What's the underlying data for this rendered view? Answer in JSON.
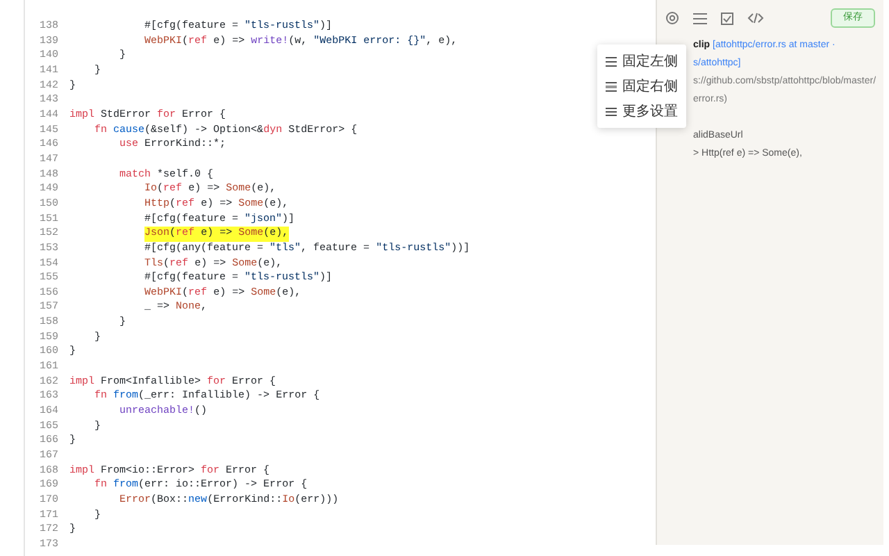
{
  "code_lines": [
    {
      "number": "138",
      "highlighted": false,
      "tokens": [
        {
          "kind": "plain",
          "text": "            #[cfg(feature = "
        },
        {
          "kind": "string",
          "text": "\"tls-rustls\""
        },
        {
          "kind": "plain",
          "text": ")]"
        }
      ]
    },
    {
      "number": "139",
      "highlighted": false,
      "tokens": [
        {
          "kind": "variant",
          "text": "            WebPKI"
        },
        {
          "kind": "plain",
          "text": "("
        },
        {
          "kind": "keyword",
          "text": "ref"
        },
        {
          "kind": "plain",
          "text": " e) => "
        },
        {
          "kind": "macro",
          "text": "write!"
        },
        {
          "kind": "plain",
          "text": "(w, "
        },
        {
          "kind": "string",
          "text": "\"WebPKI error: {}\""
        },
        {
          "kind": "plain",
          "text": ", e),"
        }
      ]
    },
    {
      "number": "140",
      "highlighted": false,
      "tokens": [
        {
          "kind": "plain",
          "text": "        }"
        }
      ]
    },
    {
      "number": "141",
      "highlighted": false,
      "tokens": [
        {
          "kind": "plain",
          "text": "    }"
        }
      ]
    },
    {
      "number": "142",
      "highlighted": false,
      "tokens": [
        {
          "kind": "plain",
          "text": "}"
        }
      ]
    },
    {
      "number": "143"
    },
    {
      "number": "144",
      "highlighted": false,
      "tokens": [
        {
          "kind": "keyword",
          "text": "impl"
        },
        {
          "kind": "plain",
          "text": " StdError "
        },
        {
          "kind": "keyword",
          "text": "for"
        },
        {
          "kind": "plain",
          "text": " Error {"
        }
      ]
    },
    {
      "number": "145",
      "highlighted": false,
      "tokens": [
        {
          "kind": "keyword",
          "text": "    fn"
        },
        {
          "kind": "function",
          "text": " cause"
        },
        {
          "kind": "plain",
          "text": "(&self) -> Option<&"
        },
        {
          "kind": "keyword",
          "text": "dyn"
        },
        {
          "kind": "plain",
          "text": " StdError> {"
        }
      ]
    },
    {
      "number": "146",
      "highlighted": false,
      "tokens": [
        {
          "kind": "keyword",
          "text": "        use"
        },
        {
          "kind": "plain",
          "text": " ErrorKind::*;"
        }
      ]
    },
    {
      "number": "147"
    },
    {
      "number": "148",
      "highlighted": false,
      "tokens": [
        {
          "kind": "keyword",
          "text": "        match"
        },
        {
          "kind": "plain",
          "text": " *self.0 {"
        }
      ]
    },
    {
      "number": "149",
      "highlighted": false,
      "tokens": [
        {
          "kind": "variant",
          "text": "            Io"
        },
        {
          "kind": "plain",
          "text": "("
        },
        {
          "kind": "keyword",
          "text": "ref"
        },
        {
          "kind": "plain",
          "text": " e) => "
        },
        {
          "kind": "variant",
          "text": "Some"
        },
        {
          "kind": "plain",
          "text": "(e),"
        }
      ]
    },
    {
      "number": "150",
      "highlighted": false,
      "tokens": [
        {
          "kind": "variant",
          "text": "            Http"
        },
        {
          "kind": "plain",
          "text": "("
        },
        {
          "kind": "keyword",
          "text": "ref"
        },
        {
          "kind": "plain",
          "text": " e) => "
        },
        {
          "kind": "variant",
          "text": "Some"
        },
        {
          "kind": "plain",
          "text": "(e),"
        }
      ]
    },
    {
      "number": "151",
      "highlighted": false,
      "tokens": [
        {
          "kind": "plain",
          "text": "            #[cfg(feature = "
        },
        {
          "kind": "string",
          "text": "\"json\""
        },
        {
          "kind": "plain",
          "text": ")]"
        }
      ]
    },
    {
      "number": "152",
      "highlighted": true,
      "tokens": [
        {
          "kind": "variant",
          "text": "            Json"
        },
        {
          "kind": "plain",
          "text": "("
        },
        {
          "kind": "keyword",
          "text": "ref"
        },
        {
          "kind": "plain",
          "text": " e) => "
        },
        {
          "kind": "variant",
          "text": "Some"
        },
        {
          "kind": "plain",
          "text": "(e),"
        }
      ]
    },
    {
      "number": "153",
      "highlighted": false,
      "tokens": [
        {
          "kind": "plain",
          "text": "            #[cfg(any(feature = "
        },
        {
          "kind": "string",
          "text": "\"tls\""
        },
        {
          "kind": "plain",
          "text": ", feature = "
        },
        {
          "kind": "string",
          "text": "\"tls-rustls\""
        },
        {
          "kind": "plain",
          "text": "))]"
        }
      ]
    },
    {
      "number": "154",
      "highlighted": false,
      "tokens": [
        {
          "kind": "variant",
          "text": "            Tls"
        },
        {
          "kind": "plain",
          "text": "("
        },
        {
          "kind": "keyword",
          "text": "ref"
        },
        {
          "kind": "plain",
          "text": " e) => "
        },
        {
          "kind": "variant",
          "text": "Some"
        },
        {
          "kind": "plain",
          "text": "(e),"
        }
      ]
    },
    {
      "number": "155",
      "highlighted": false,
      "tokens": [
        {
          "kind": "plain",
          "text": "            #[cfg(feature = "
        },
        {
          "kind": "string",
          "text": "\"tls-rustls\""
        },
        {
          "kind": "plain",
          "text": ")]"
        }
      ]
    },
    {
      "number": "156",
      "highlighted": false,
      "tokens": [
        {
          "kind": "variant",
          "text": "            WebPKI"
        },
        {
          "kind": "plain",
          "text": "("
        },
        {
          "kind": "keyword",
          "text": "ref"
        },
        {
          "kind": "plain",
          "text": " e) => "
        },
        {
          "kind": "variant",
          "text": "Some"
        },
        {
          "kind": "plain",
          "text": "(e),"
        }
      ]
    },
    {
      "number": "157",
      "highlighted": false,
      "tokens": [
        {
          "kind": "plain",
          "text": "            _ => "
        },
        {
          "kind": "variant",
          "text": "None"
        },
        {
          "kind": "plain",
          "text": ","
        }
      ]
    },
    {
      "number": "158",
      "highlighted": false,
      "tokens": [
        {
          "kind": "plain",
          "text": "        }"
        }
      ]
    },
    {
      "number": "159",
      "highlighted": false,
      "tokens": [
        {
          "kind": "plain",
          "text": "    }"
        }
      ]
    },
    {
      "number": "160",
      "highlighted": false,
      "tokens": [
        {
          "kind": "plain",
          "text": "}"
        }
      ]
    },
    {
      "number": "161"
    },
    {
      "number": "162",
      "highlighted": false,
      "tokens": [
        {
          "kind": "keyword",
          "text": "impl"
        },
        {
          "kind": "plain",
          "text": " From<Infallible> "
        },
        {
          "kind": "keyword",
          "text": "for"
        },
        {
          "kind": "plain",
          "text": " Error {"
        }
      ]
    },
    {
      "number": "163",
      "highlighted": false,
      "tokens": [
        {
          "kind": "keyword",
          "text": "    fn"
        },
        {
          "kind": "function",
          "text": " from"
        },
        {
          "kind": "plain",
          "text": "(_err: Infallible) -> Error {"
        }
      ]
    },
    {
      "number": "164",
      "highlighted": false,
      "tokens": [
        {
          "kind": "macro",
          "text": "        unreachable!"
        },
        {
          "kind": "plain",
          "text": "()"
        }
      ]
    },
    {
      "number": "165",
      "highlighted": false,
      "tokens": [
        {
          "kind": "plain",
          "text": "    }"
        }
      ]
    },
    {
      "number": "166",
      "highlighted": false,
      "tokens": [
        {
          "kind": "plain",
          "text": "}"
        }
      ]
    },
    {
      "number": "167"
    },
    {
      "number": "168",
      "highlighted": false,
      "tokens": [
        {
          "kind": "keyword",
          "text": "impl"
        },
        {
          "kind": "plain",
          "text": " From<io::Error> "
        },
        {
          "kind": "keyword",
          "text": "for"
        },
        {
          "kind": "plain",
          "text": " Error {"
        }
      ]
    },
    {
      "number": "169",
      "highlighted": false,
      "tokens": [
        {
          "kind": "keyword",
          "text": "    fn"
        },
        {
          "kind": "function",
          "text": " from"
        },
        {
          "kind": "plain",
          "text": "(err: io::Error) -> Error {"
        }
      ]
    },
    {
      "number": "170",
      "highlighted": false,
      "tokens": [
        {
          "kind": "variant",
          "text": "        Error"
        },
        {
          "kind": "plain",
          "text": "(Box::"
        },
        {
          "kind": "function",
          "text": "new"
        },
        {
          "kind": "plain",
          "text": "(ErrorKind::"
        },
        {
          "kind": "variant",
          "text": "Io"
        },
        {
          "kind": "plain",
          "text": "(err)))"
        }
      ]
    },
    {
      "number": "171",
      "highlighted": false,
      "tokens": [
        {
          "kind": "plain",
          "text": "    }"
        }
      ]
    },
    {
      "number": "172",
      "highlighted": false,
      "tokens": [
        {
          "kind": "plain",
          "text": "}"
        }
      ]
    },
    {
      "number": "173"
    }
  ],
  "side_panel": {
    "save_button": "保存",
    "lines": [
      {
        "kind": "title",
        "bold": "clip",
        "link": "[attohttpc/error.rs at master ·"
      },
      {
        "kind": "link",
        "text": "s/attohttpc]"
      },
      {
        "kind": "url",
        "text": "s://github.com/sbstp/attohttpc/blob/master/"
      },
      {
        "kind": "url",
        "text": "error.rs)"
      },
      {
        "kind": "blank"
      },
      {
        "kind": "text",
        "text": "alidBaseUrl"
      },
      {
        "kind": "text",
        "text": "> Http(ref e) => Some(e),"
      }
    ]
  },
  "dock_menu": {
    "items": [
      {
        "kind": "left",
        "label": "固定左侧"
      },
      {
        "kind": "right",
        "label": "固定右侧"
      },
      {
        "kind": "settings",
        "label": "更多设置"
      }
    ]
  }
}
